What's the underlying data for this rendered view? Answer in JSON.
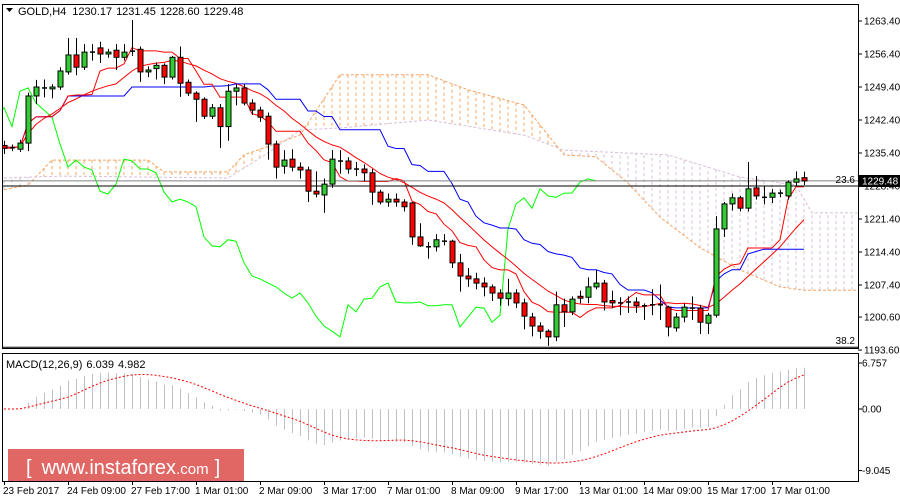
{
  "header": {
    "symbol": "GOLD,H4",
    "open": "1230.17",
    "high": "1231.45",
    "low": "1228.60",
    "close": "1229.48"
  },
  "macd_label": {
    "name": "MACD(12,26,9)",
    "main": "6.039",
    "signal": "4.982"
  },
  "current_price_label": "1229.48",
  "watermark": {
    "open": "[",
    "site": "www.instaforex",
    "tld": ".com",
    "close": "]"
  },
  "colors": {
    "bull": "#32cd32",
    "bear": "#ff0000",
    "tenkan": "#ff0000",
    "kijun": "#0000ff",
    "chikou": "#00ff00",
    "span_a": "#f4a460",
    "span_b": "#d8bfd8",
    "ma": "#ff0000",
    "macd_hist": "#c0c0c0",
    "macd_signal": "#ff0000",
    "watermark": "#d9413f"
  },
  "chart_data": {
    "type": "candlestick",
    "title": "GOLD,H4",
    "price_axis": {
      "min": 1193.6,
      "max": 1263.4,
      "ticks": [
        "1263.40",
        "1256.40",
        "1249.40",
        "1242.40",
        "1235.40",
        "1228.40",
        "1221.40",
        "1214.40",
        "1207.40",
        "1200.60",
        "1193.60"
      ]
    },
    "time_labels": [
      "23 Feb 2017",
      "24 Feb 09:00",
      "27 Feb 17:00",
      "1 Mar 01:00",
      "2 Mar 09:00",
      "3 Mar 17:00",
      "7 Mar 01:00",
      "8 Mar 09:00",
      "9 Mar 17:00",
      "13 Mar 01:00",
      "14 Mar 09:00",
      "15 Mar 17:00",
      "17 Mar 01:00"
    ],
    "time_label_every_bars": 8,
    "fib_levels": [
      {
        "label": "23.6",
        "price": 1228.4
      },
      {
        "label": "38.2",
        "price": 1194.2
      }
    ],
    "ichimoku": {
      "tenkan": 9,
      "kijun": 26,
      "shift": 26
    },
    "ma_period": 15,
    "span_a": [
      [
        0,
        1227.6
      ],
      [
        3,
        1228.6
      ],
      [
        6,
        1233.9
      ],
      [
        18,
        1233.9
      ],
      [
        20,
        1231.4
      ],
      [
        28,
        1231.4
      ],
      [
        30,
        1235.0
      ],
      [
        37,
        1239.2
      ],
      [
        42,
        1252.0
      ],
      [
        53,
        1252.0
      ],
      [
        58,
        1248.8
      ],
      [
        65,
        1245.6
      ],
      [
        70,
        1235.0
      ],
      [
        74,
        1234.6
      ],
      [
        78,
        1229.0
      ],
      [
        82,
        1221.8
      ],
      [
        87,
        1215.3
      ],
      [
        92,
        1210.6
      ],
      [
        97,
        1207.0
      ],
      [
        100,
        1206.3
      ],
      [
        107,
        1206.3
      ]
    ],
    "span_b": [
      [
        0,
        1230.1
      ],
      [
        7,
        1230.5
      ],
      [
        28,
        1230.1
      ],
      [
        33,
        1235.4
      ],
      [
        37,
        1240.3
      ],
      [
        42,
        1240.7
      ],
      [
        53,
        1242.4
      ],
      [
        65,
        1239.2
      ],
      [
        70,
        1236.0
      ],
      [
        83,
        1235.0
      ],
      [
        92,
        1230.3
      ],
      [
        99,
        1228.6
      ],
      [
        101,
        1222.7
      ],
      [
        107,
        1222.7
      ]
    ],
    "macd_axis": {
      "min": -9.045,
      "max": 6.757,
      "ticks": [
        "6.757",
        "0.00",
        "-9.045"
      ]
    },
    "ohlc": [
      [
        1237.0,
        1238.0,
        1235.2,
        1236.4
      ],
      [
        1236.4,
        1237.2,
        1235.8,
        1236.5
      ],
      [
        1236.2,
        1238.2,
        1235.6,
        1237.5
      ],
      [
        1237.5,
        1248.2,
        1235.8,
        1247.5
      ],
      [
        1247.5,
        1250.9,
        1245.8,
        1249.4
      ],
      [
        1249.2,
        1251.0,
        1247.2,
        1249.2
      ],
      [
        1249.0,
        1250.0,
        1247.0,
        1249.4
      ],
      [
        1249.4,
        1253.6,
        1248.8,
        1252.8
      ],
      [
        1252.6,
        1259.8,
        1252.0,
        1256.2
      ],
      [
        1256.2,
        1259.8,
        1251.9,
        1253.6
      ],
      [
        1253.6,
        1258.5,
        1253.0,
        1256.8
      ],
      [
        1256.8,
        1258.5,
        1255.0,
        1256.8
      ],
      [
        1257.7,
        1259.0,
        1254.5,
        1256.4
      ],
      [
        1256.4,
        1257.5,
        1255.6,
        1256.8
      ],
      [
        1257.2,
        1258.5,
        1253.0,
        1255.7
      ],
      [
        1255.7,
        1258.5,
        1255.0,
        1256.8
      ],
      [
        1257.0,
        1263.6,
        1256.0,
        1257.0
      ],
      [
        1257.4,
        1258.0,
        1250.5,
        1252.6
      ],
      [
        1252.6,
        1253.8,
        1251.5,
        1253.0
      ],
      [
        1253.3,
        1254.6,
        1251.0,
        1254.0
      ],
      [
        1254.0,
        1254.4,
        1250.0,
        1251.5
      ],
      [
        1251.5,
        1256.0,
        1251.0,
        1255.7
      ],
      [
        1255.7,
        1258.0,
        1247.3,
        1250.2
      ],
      [
        1250.4,
        1251.0,
        1247.5,
        1248.1
      ],
      [
        1248.1,
        1248.5,
        1242.0,
        1246.8
      ],
      [
        1246.8,
        1247.2,
        1242.6,
        1243.2
      ],
      [
        1243.2,
        1245.8,
        1242.6,
        1245.0
      ],
      [
        1245.0,
        1245.8,
        1236.5,
        1241.0
      ],
      [
        1241.0,
        1250.0,
        1238.0,
        1248.5
      ],
      [
        1248.5,
        1250.0,
        1245.5,
        1249.2
      ],
      [
        1249.2,
        1250.0,
        1245.5,
        1246.0
      ],
      [
        1246.0,
        1246.8,
        1243.5,
        1244.5
      ],
      [
        1244.5,
        1245.2,
        1242.0,
        1243.0
      ],
      [
        1243.2,
        1244.0,
        1234.0,
        1237.3
      ],
      [
        1237.3,
        1238.0,
        1230.0,
        1232.4
      ],
      [
        1232.6,
        1236.0,
        1231.0,
        1233.9
      ],
      [
        1234.1,
        1236.2,
        1231.5,
        1232.4
      ],
      [
        1232.4,
        1233.4,
        1230.0,
        1231.8
      ],
      [
        1231.8,
        1232.5,
        1225.0,
        1227.3
      ],
      [
        1227.3,
        1231.5,
        1226.0,
        1226.7
      ],
      [
        1226.5,
        1230.0,
        1222.7,
        1228.8
      ],
      [
        1228.8,
        1236.0,
        1228.0,
        1234.1
      ],
      [
        1233.7,
        1236.0,
        1231.0,
        1233.7
      ],
      [
        1233.7,
        1234.5,
        1231.0,
        1232.0
      ],
      [
        1232.0,
        1233.5,
        1230.5,
        1232.0
      ],
      [
        1232.0,
        1233.0,
        1229.5,
        1231.2
      ],
      [
        1231.2,
        1232.0,
        1224.4,
        1227.1
      ],
      [
        1227.1,
        1227.6,
        1224.5,
        1225.0
      ],
      [
        1225.0,
        1226.8,
        1224.0,
        1225.6
      ],
      [
        1225.6,
        1226.8,
        1224.0,
        1225.0
      ],
      [
        1225.0,
        1225.6,
        1223.0,
        1224.0
      ],
      [
        1224.8,
        1225.0,
        1215.9,
        1217.6
      ],
      [
        1217.6,
        1220.5,
        1215.5,
        1215.7
      ],
      [
        1215.5,
        1216.5,
        1213.0,
        1215.5
      ],
      [
        1215.5,
        1218.2,
        1214.5,
        1217.0
      ],
      [
        1216.7,
        1218.2,
        1215.8,
        1216.7
      ],
      [
        1216.7,
        1217.0,
        1211.0,
        1212.1
      ],
      [
        1212.1,
        1214.0,
        1206.0,
        1209.3
      ],
      [
        1209.3,
        1211.0,
        1207.0,
        1208.7
      ],
      [
        1208.7,
        1210.0,
        1206.5,
        1207.8
      ],
      [
        1207.8,
        1209.0,
        1205.0,
        1207.0
      ],
      [
        1207.0,
        1207.5,
        1204.0,
        1205.7
      ],
      [
        1205.7,
        1206.5,
        1203.0,
        1204.6
      ],
      [
        1204.5,
        1208.7,
        1203.0,
        1205.7
      ],
      [
        1205.7,
        1206.5,
        1202.5,
        1203.6
      ],
      [
        1203.6,
        1204.5,
        1198.0,
        1200.8
      ],
      [
        1200.6,
        1201.5,
        1196.5,
        1198.7
      ],
      [
        1198.7,
        1199.5,
        1196.0,
        1197.6
      ],
      [
        1197.6,
        1198.0,
        1194.5,
        1196.4
      ],
      [
        1196.4,
        1206.0,
        1195.5,
        1203.2
      ],
      [
        1203.2,
        1204.5,
        1198.5,
        1201.7
      ],
      [
        1201.7,
        1205.0,
        1201.0,
        1204.4
      ],
      [
        1205.0,
        1206.2,
        1203.5,
        1204.6
      ],
      [
        1204.8,
        1209.0,
        1203.5,
        1207.0
      ],
      [
        1207.0,
        1210.6,
        1206.5,
        1207.8
      ],
      [
        1207.8,
        1208.5,
        1202.0,
        1203.8
      ],
      [
        1204.1,
        1206.2,
        1202.5,
        1203.6
      ],
      [
        1203.6,
        1204.8,
        1201.0,
        1203.6
      ],
      [
        1203.8,
        1205.0,
        1201.5,
        1203.8
      ],
      [
        1203.8,
        1204.8,
        1201.5,
        1203.0
      ],
      [
        1203.0,
        1203.5,
        1200.0,
        1203.0
      ],
      [
        1203.2,
        1206.5,
        1201.0,
        1203.2
      ],
      [
        1203.2,
        1207.5,
        1200.0,
        1203.2
      ],
      [
        1202.7,
        1203.0,
        1196.5,
        1198.5
      ],
      [
        1198.3,
        1201.5,
        1197.5,
        1200.6
      ],
      [
        1200.6,
        1203.5,
        1199.5,
        1202.7
      ],
      [
        1202.5,
        1205.0,
        1200.0,
        1202.5
      ],
      [
        1202.5,
        1203.2,
        1197.0,
        1199.5
      ],
      [
        1199.3,
        1201.5,
        1197.0,
        1201.0
      ],
      [
        1201.0,
        1222.0,
        1200.5,
        1219.3
      ],
      [
        1219.3,
        1225.0,
        1217.6,
        1224.6
      ],
      [
        1224.6,
        1226.8,
        1223.2,
        1225.9
      ],
      [
        1225.9,
        1226.3,
        1223.0,
        1223.7
      ],
      [
        1223.7,
        1233.5,
        1223.0,
        1227.8
      ],
      [
        1228.0,
        1230.5,
        1225.5,
        1226.3
      ],
      [
        1226.0,
        1228.3,
        1224.5,
        1226.0
      ],
      [
        1226.0,
        1227.8,
        1224.8,
        1226.9
      ],
      [
        1226.9,
        1227.6,
        1226.0,
        1226.9
      ],
      [
        1226.3,
        1229.6,
        1225.5,
        1229.2
      ],
      [
        1229.2,
        1231.5,
        1228.5,
        1229.9
      ],
      [
        1230.17,
        1231.45,
        1228.6,
        1229.48
      ]
    ]
  }
}
